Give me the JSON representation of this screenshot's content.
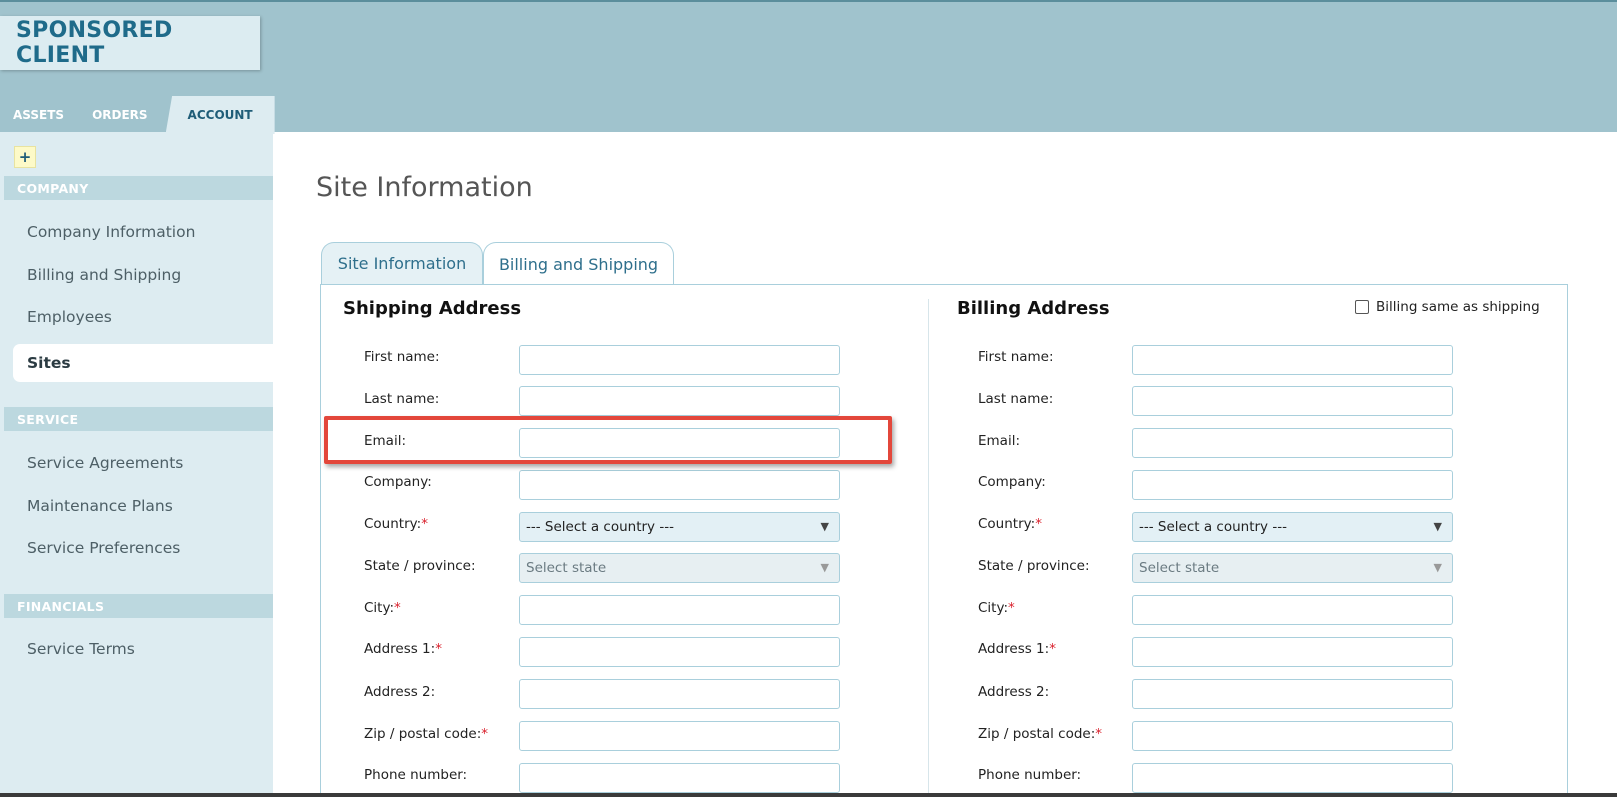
{
  "brand": {
    "title": "SPONSORED CLIENT"
  },
  "top_tabs": [
    {
      "label": "ASSETS"
    },
    {
      "label": "ORDERS"
    },
    {
      "label": "ACCOUNT"
    }
  ],
  "sidebar": {
    "add_label": "+",
    "sections": [
      {
        "title": "COMPANY",
        "items": [
          "Company Information",
          "Billing and Shipping",
          "Employees",
          "Sites"
        ]
      },
      {
        "title": "SERVICE",
        "items": [
          "Service Agreements",
          "Maintenance Plans",
          "Service Preferences"
        ]
      },
      {
        "title": "FINANCIALS",
        "items": [
          "Service Terms"
        ]
      }
    ],
    "active_item": "Sites"
  },
  "page": {
    "title": "Site Information"
  },
  "form_tabs": [
    {
      "label": "Site Information"
    },
    {
      "label": "Billing and Shipping",
      "active": true
    }
  ],
  "shipping": {
    "title": "Shipping Address",
    "labels": {
      "first_name": "First name:",
      "last_name": "Last name:",
      "email": "Email:",
      "company": "Company:",
      "country": "Country:",
      "state": "State / province:",
      "city": "City:",
      "address1": "Address 1:",
      "address2": "Address 2:",
      "zip": "Zip / postal code:",
      "phone": "Phone number:"
    },
    "country_value": "--- Select a country ---",
    "state_value": "Select state"
  },
  "billing": {
    "title": "Billing Address",
    "same_as_shipping_label": "Billing same as shipping",
    "same_as_shipping_checked": false,
    "labels": {
      "first_name": "First name:",
      "last_name": "Last name:",
      "email": "Email:",
      "company": "Company:",
      "country": "Country:",
      "state": "State / province:",
      "city": "City:",
      "address1": "Address 1:",
      "address2": "Address 2:",
      "zip": "Zip / postal code:",
      "phone": "Phone number:"
    },
    "country_value": "--- Select a country ---",
    "state_value": "Select state"
  },
  "required_marker": "*",
  "caret_glyph": "▼",
  "colors": {
    "accent": "#1f6b8a",
    "header_bg": "#a0c3cd",
    "sidebar_bg": "#ddecf1",
    "highlight": "#e3473b",
    "required": "#d9202c"
  }
}
